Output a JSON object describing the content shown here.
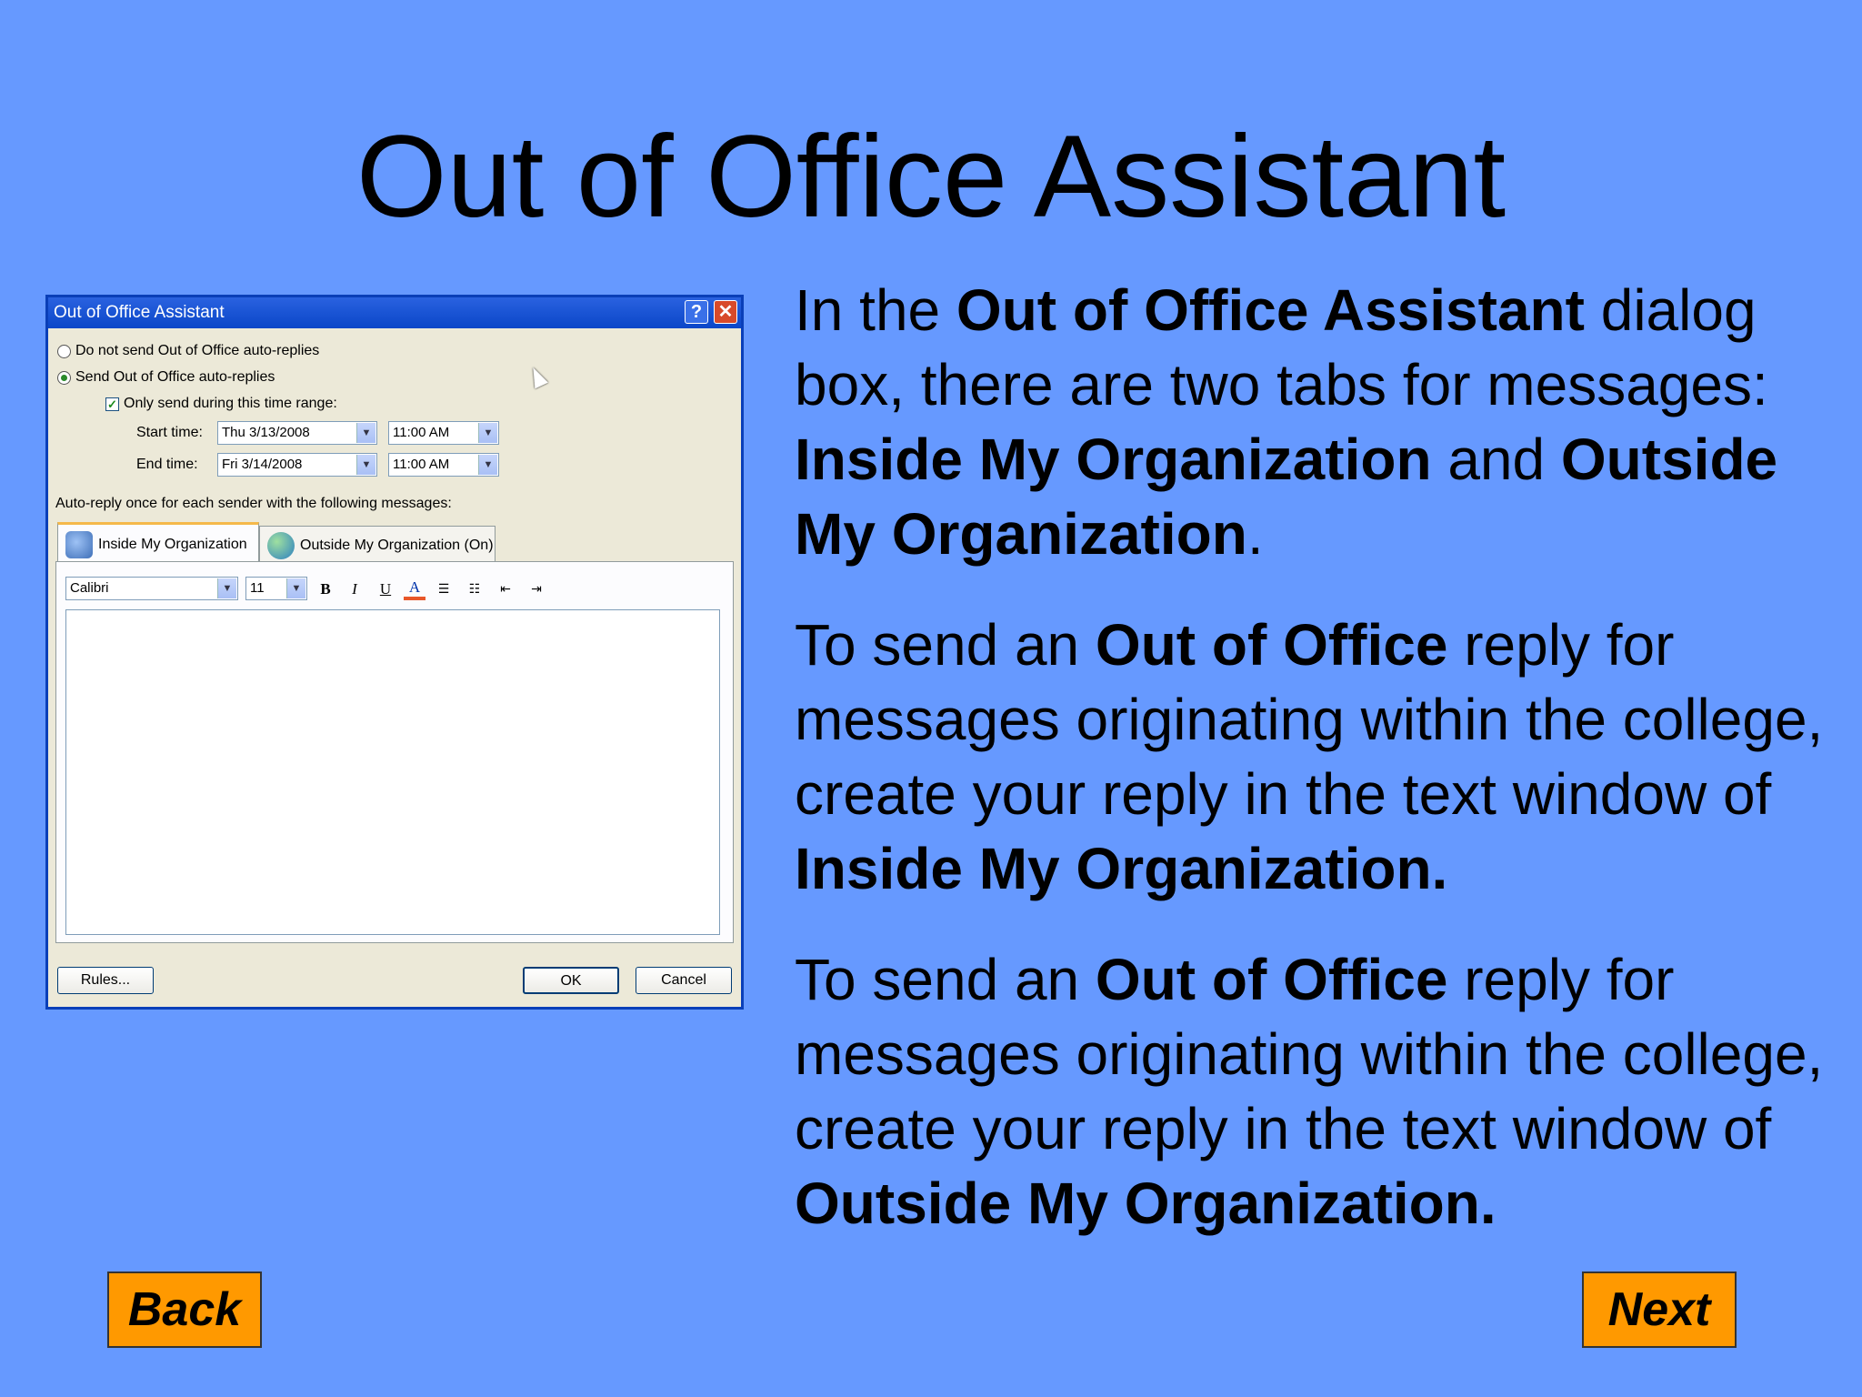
{
  "slide": {
    "title": "Out of Office Assistant",
    "paragraphs": [
      {
        "t1": "In the ",
        "b1": "Out of Office Assistant",
        "t2": " dialog box, there are two tabs for messages:  ",
        "b2": "Inside My Organization",
        "t3": " and ",
        "b3": "Outside My Organization",
        "t4": "."
      },
      {
        "t1": "To send an ",
        "b1": "Out of Office",
        "t2": " reply for messages originating within the college, create your reply in the text window of ",
        "b2": "Inside My Organization."
      },
      {
        "t1": "To send an ",
        "b1": "Out of Office",
        "t2": " reply for messages originating within the college, create your reply in the text window of ",
        "b2": "Outside My Organization."
      }
    ],
    "back_label": "Back",
    "next_label": "Next"
  },
  "dialog": {
    "title": "Out of Office Assistant",
    "help_glyph": "?",
    "close_glyph": "✕",
    "radio_off_label": "Do not send Out of Office auto-replies",
    "radio_on_label": "Send Out of Office auto-replies",
    "checkbox_label": "Only send during this time range:",
    "start_label": "Start time:",
    "start_date": "Thu 3/13/2008",
    "start_time": "11:00 AM",
    "end_label": "End time:",
    "end_date": "Fri 3/14/2008",
    "end_time": "11:00 AM",
    "autoreply_label": "Auto-reply once for each sender with the following messages:",
    "tab_inside": "Inside My Organization",
    "tab_outside": "Outside My Organization (On)",
    "font_name": "Calibri",
    "font_size": "11",
    "rules_label": "Rules...",
    "ok_label": "OK",
    "cancel_label": "Cancel"
  },
  "colors": {
    "background": "#6699ff",
    "nav_button": "#ff9900",
    "titlebar": "#0a46c8"
  }
}
